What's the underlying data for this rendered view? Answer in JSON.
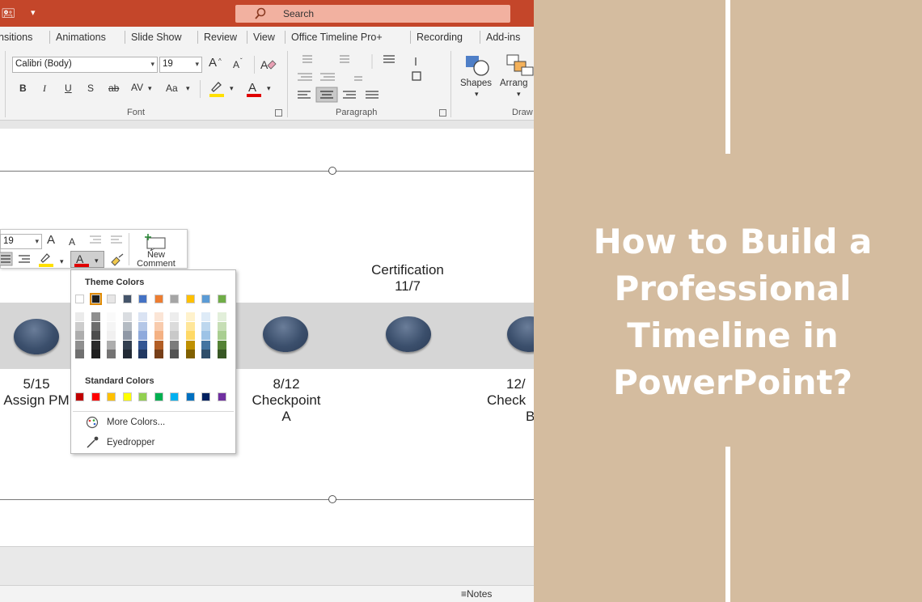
{
  "app": {
    "search_label": "Search",
    "tabs": [
      "nsitions",
      "Animations",
      "Slide Show",
      "Review",
      "View",
      "Office Timeline Pro+",
      "Recording",
      "Add-ins"
    ]
  },
  "ribbon": {
    "font_name": "Calibri (Body)",
    "font_size": "19",
    "grow_font": "A",
    "shrink_font": "A",
    "bold": "B",
    "italic": "I",
    "underline": "U",
    "shadow": "S",
    "strikethrough": "ab",
    "char_spacing": "AV",
    "change_case": "Aa",
    "font_group_label": "Font",
    "paragraph_group_label": "Paragraph",
    "shapes_label": "Shapes",
    "arrange_label": "Arrang",
    "drawing_group_label": "Draw"
  },
  "mini_toolbar": {
    "font_size": "19",
    "new_comment_label_1": "New",
    "new_comment_label_2": "Comment"
  },
  "palette": {
    "theme_header": "Theme Colors",
    "standard_header": "Standard Colors",
    "more_colors": "More Colors...",
    "eyedropper": "Eyedropper",
    "theme_top_row": [
      "#ffffff",
      "#1f1f1f",
      "#e7e6e6",
      "#44546a",
      "#4472c4",
      "#ed7d31",
      "#a5a5a5",
      "#ffc000",
      "#5b9bd5",
      "#70ad47"
    ],
    "standard_row": [
      "#c00000",
      "#ff0000",
      "#ffc000",
      "#ffff00",
      "#92d050",
      "#00b050",
      "#00b0f0",
      "#0070c0",
      "#002060",
      "#7030a0"
    ]
  },
  "slide": {
    "milestones_top": [
      {
        "line1": "Certification",
        "line2": "11/7"
      }
    ],
    "milestones_bottom": [
      {
        "line1": "5/15",
        "line2": "Assign PM",
        "line3": ""
      },
      {
        "line1": "8/12",
        "line2": "Checkpoint",
        "line3": "A"
      },
      {
        "line1": "12/",
        "line2": "Check",
        "line3": "B"
      }
    ]
  },
  "status": {
    "notes_label": "Notes"
  },
  "headline": {
    "line1": "How to Build a",
    "line2": "Professional",
    "line3": "Timeline in",
    "line4": "PowerPoint?"
  },
  "colors": {
    "background": "#d4bc9f",
    "title_bar": "#c4462a",
    "milestone_dot": "#3b4f6c",
    "headline_text": "#ffffff"
  }
}
